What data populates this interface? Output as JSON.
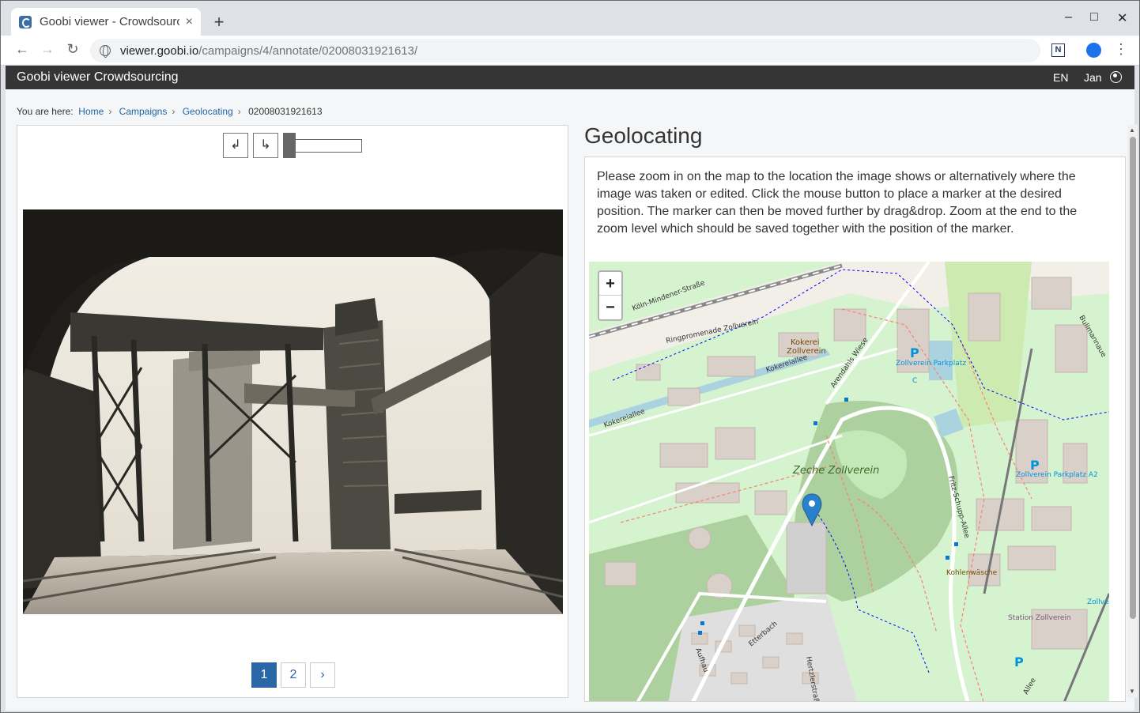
{
  "browser": {
    "tab_title": "Goobi viewer - Crowdsourcing",
    "tab_close": "×",
    "new_tab": "+",
    "url_host": "viewer.goobi.io",
    "url_path": "/campaigns/4/annotate/02008031921613/",
    "window_controls": [
      "–",
      "□",
      "✕"
    ]
  },
  "header": {
    "title": "Goobi viewer Crowdsourcing",
    "language": "EN",
    "user": "Jan"
  },
  "breadcrumb": {
    "prefix": "You are here:",
    "items": [
      "Home",
      "Campaigns",
      "Geolocating"
    ],
    "current": "02008031921613"
  },
  "viewer": {
    "rotate_left": "↲",
    "rotate_right": "↳",
    "pages": [
      "1",
      "2"
    ],
    "active_page": 1,
    "next": "›"
  },
  "task": {
    "title": "Geolocating",
    "description": "Please zoom in on the map to the location the image shows or alternatively where the image was taken or edited. Click the mouse button to place a marker at the desired position. The marker can then be moved further by drag&drop. Zoom at the end to the zoom level which should be saved together with the position of the marker."
  },
  "map": {
    "zoom_in": "+",
    "zoom_out": "−",
    "labels": [
      "Köln-Mindener-Straße",
      "Ringpromenade Zollverein",
      "Kokerei",
      "Zollverein",
      "Arendahls Wiese",
      "Kokereiallee",
      "Zollverein Parkplatz",
      "C",
      "Zeche Zollverein",
      "Zollverein Parkplatz A2",
      "Fritz-Schupp-Allee",
      "Kohlenwäsche",
      "Station Zollverein",
      "Etterbach",
      "Hertzlerstraße",
      "Aufhau",
      "Bullmannaue",
      "Allee",
      "Zollver"
    ],
    "parking_label": "P",
    "colors": {
      "park": "#d5f3cf",
      "forest": "#add19e",
      "building": "#d9d0c9",
      "marker": "#2a81cb"
    }
  }
}
